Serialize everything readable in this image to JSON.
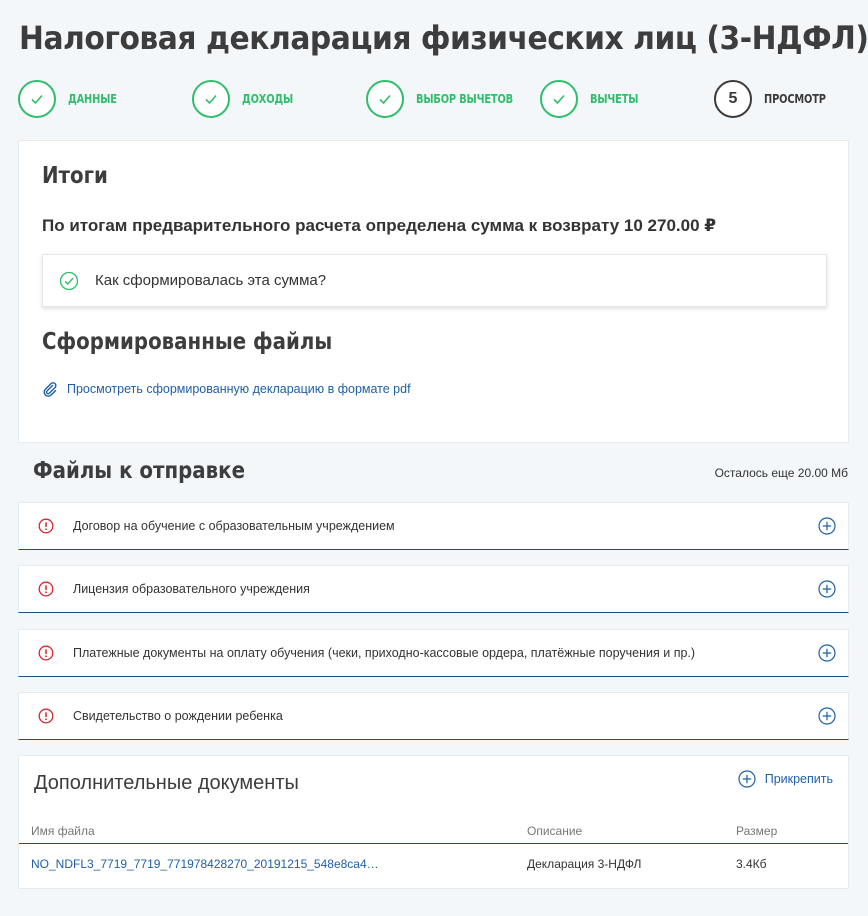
{
  "page": {
    "title": "Налоговая декларация физических лиц (3-НДФЛ)"
  },
  "stepper": {
    "steps": [
      {
        "label": "ДАННЫЕ",
        "state": "done",
        "icon": "check-icon"
      },
      {
        "label": "ДОХОДЫ",
        "state": "done",
        "icon": "check-icon"
      },
      {
        "label": "ВЫБОР ВЫЧЕТОВ",
        "state": "done",
        "icon": "check-icon"
      },
      {
        "label": "ВЫЧЕТЫ",
        "state": "done",
        "icon": "check-icon"
      },
      {
        "label": "ПРОСМОТР",
        "state": "current",
        "number": "5"
      }
    ]
  },
  "results": {
    "title": "Итоги",
    "summary": "По итогам предварительного расчета определена сумма к возврату 10 270.00 ₽",
    "how_label": "Как сформировалась эта сумма?",
    "files_title": "Сформированные файлы",
    "pdf_link": "Просмотреть сформированную декларацию в формате pdf"
  },
  "files_to_send": {
    "title": "Файлы к отправке",
    "quota": "Осталось еще 20.00 Мб",
    "items": [
      {
        "label": "Договор на обучение с образовательным учреждением"
      },
      {
        "label": "Лицензия образовательного учреждения"
      },
      {
        "label": "Платежные документы на оплату обучения (чеки, приходно-кассовые ордера, платёжные поручения и пр.)"
      },
      {
        "label": "Свидетельство о рождении ребенка"
      }
    ]
  },
  "additional": {
    "title": "Дополнительные документы",
    "attach_label": "Прикрепить",
    "columns": [
      "Имя файла",
      "Описание",
      "Размер"
    ],
    "rows": [
      {
        "name": "NO_NDFL3_7719_7719_771978428270_20191215_548e8ca4…",
        "description": "Декларация 3-НДФЛ",
        "size": "3.4Кб"
      }
    ]
  },
  "colors": {
    "accent_green": "#2fbe6b",
    "link_blue": "#1f5fa8",
    "warn_red": "#d9262f",
    "divider_navy": "#1f4f7a"
  }
}
